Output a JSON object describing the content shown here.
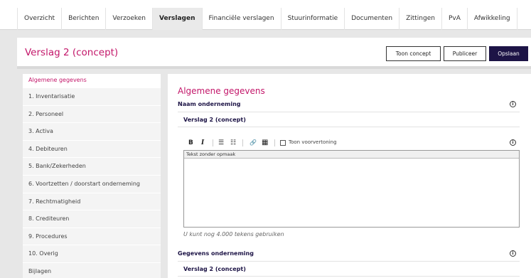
{
  "nav": {
    "tabs": [
      {
        "label": "Overzicht"
      },
      {
        "label": "Berichten"
      },
      {
        "label": "Verzoeken"
      },
      {
        "label": "Verslagen"
      },
      {
        "label": "Financiële verslagen"
      },
      {
        "label": "Stuurinformatie"
      },
      {
        "label": "Documenten"
      },
      {
        "label": "Zittingen"
      },
      {
        "label": "PvA"
      },
      {
        "label": "Afwikkeling"
      }
    ],
    "active": "Verslagen"
  },
  "header": {
    "title": "Verslag 2 (concept)",
    "buttons": {
      "toon": "Toon concept",
      "publiceer": "Publiceer",
      "opslaan": "Opslaan"
    }
  },
  "sidebar": {
    "items": [
      {
        "label": "Algemene gegevens"
      },
      {
        "label": "1. Inventarisatie"
      },
      {
        "label": "2. Personeel"
      },
      {
        "label": "3. Activa"
      },
      {
        "label": "4. Debiteuren"
      },
      {
        "label": "5. Bank/Zekerheden"
      },
      {
        "label": "6. Voortzetten / doorstart onderneming"
      },
      {
        "label": "7. Rechtmatigheid"
      },
      {
        "label": "8. Crediteuren"
      },
      {
        "label": "9. Procedures"
      },
      {
        "label": "10. Overig"
      },
      {
        "label": "Bijlagen"
      }
    ]
  },
  "main": {
    "section_title": "Algemene gegevens",
    "naam": {
      "label": "Naam onderneming",
      "value": "Verslag 2 (concept)"
    },
    "editor": {
      "bold": "B",
      "italic": "I",
      "bullet_list": "☰",
      "numbered_list": "☷",
      "link": "🔗",
      "table": "▦",
      "preview_label": "Toon voorvertoning",
      "status": "Tekst zonder opmaak",
      "hint": "U kunt nog 4.000 tekens gebruiken"
    },
    "gegevens": {
      "label": "Gegevens onderneming",
      "value": "Verslag 2 (concept)"
    },
    "info_glyph": "i"
  },
  "colors": {
    "accent": "#c3176a",
    "navy": "#1d1446"
  }
}
